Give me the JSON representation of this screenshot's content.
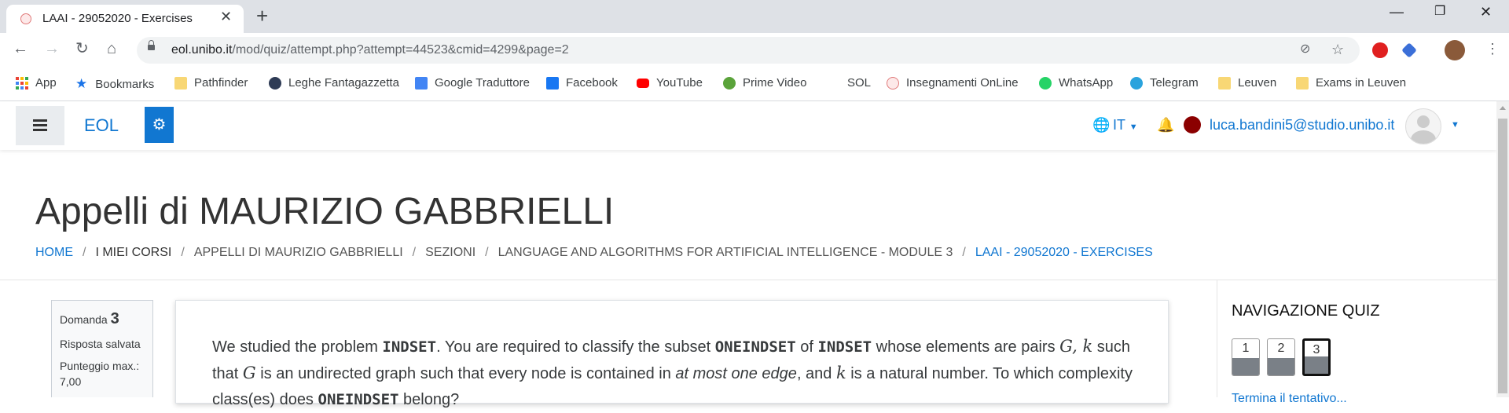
{
  "browser": {
    "tab_title": "LAAI - 29052020 - Exercises",
    "url_host": "eol.unibo.it",
    "url_path": "/mod/quiz/attempt.php?attempt=44523&cmid=4299&page=2"
  },
  "bookmarks": [
    {
      "label": "App",
      "icon": "apps-grid-icon"
    },
    {
      "label": "Bookmarks",
      "icon": "star-icon",
      "color": "#1a73e8"
    },
    {
      "label": "Pathfinder",
      "icon": "folder-icon",
      "color": "#f8d775"
    },
    {
      "label": "Leghe Fantagazzetta",
      "icon": "fantagazzetta-icon",
      "color": "#2e3b55"
    },
    {
      "label": "Google Traduttore",
      "icon": "google-translate-icon",
      "color": "#4285f4"
    },
    {
      "label": "Facebook",
      "icon": "facebook-icon",
      "color": "#1877f2"
    },
    {
      "label": "YouTube",
      "icon": "youtube-icon",
      "color": "#ff0000"
    },
    {
      "label": "Prime Video",
      "icon": "prime-video-icon",
      "color": "#5aa33a"
    },
    {
      "label": "SOL",
      "icon": "",
      "color": ""
    },
    {
      "label": "Insegnamenti OnLine",
      "icon": "unibo-icon",
      "color": "#e07a7a"
    },
    {
      "label": "WhatsApp",
      "icon": "whatsapp-icon",
      "color": "#25d366"
    },
    {
      "label": "Telegram",
      "icon": "telegram-icon",
      "color": "#2aa3dd"
    },
    {
      "label": "Leuven",
      "icon": "folder-icon",
      "color": "#f8d775"
    },
    {
      "label": "Exams in Leuven",
      "icon": "folder-icon",
      "color": "#f8d775"
    }
  ],
  "navbar": {
    "brand": "EOL",
    "language": "IT",
    "user_email": "luca.bandini5@studio.unibo.it"
  },
  "page": {
    "title": "Appelli di MAURIZIO GABBRIELLI",
    "breadcrumb": [
      "HOME",
      "I MIEI CORSI",
      "APPELLI DI MAURIZIO GABBRIELLI",
      "SEZIONI",
      "LANGUAGE AND ALGORITHMS FOR ARTIFICIAL INTELLIGENCE - MODULE 3",
      "LAAI - 29052020 - EXERCISES"
    ]
  },
  "question_info": {
    "label": "Domanda",
    "number": "3",
    "status": "Risposta salvata",
    "points_label": "Punteggio max.:",
    "points_value": "7,00"
  },
  "question": {
    "t1": "We studied the problem ",
    "m1": "INDSET",
    "t2": ". You are required to classify the subset ",
    "m2": "ONEINDSET",
    "t3": " of ",
    "m3": "INDSET",
    "t4": " whose elements are pairs ",
    "v1": "G",
    "v2": ", k",
    "t5": " such that ",
    "v3": "G",
    "t6": " is an undirected graph such that every node is contained in ",
    "em": "at most one edge",
    "t7": ", and ",
    "v4": "k",
    "t8": " is a natural number. To which complexity class(es) does ",
    "m4": "ONEINDSET",
    "t9": " belong?"
  },
  "quiz_nav": {
    "title": "NAVIGAZIONE QUIZ",
    "buttons": [
      "1",
      "2",
      "3"
    ],
    "current": "3",
    "finish_link": "Termina il tentativo..."
  }
}
